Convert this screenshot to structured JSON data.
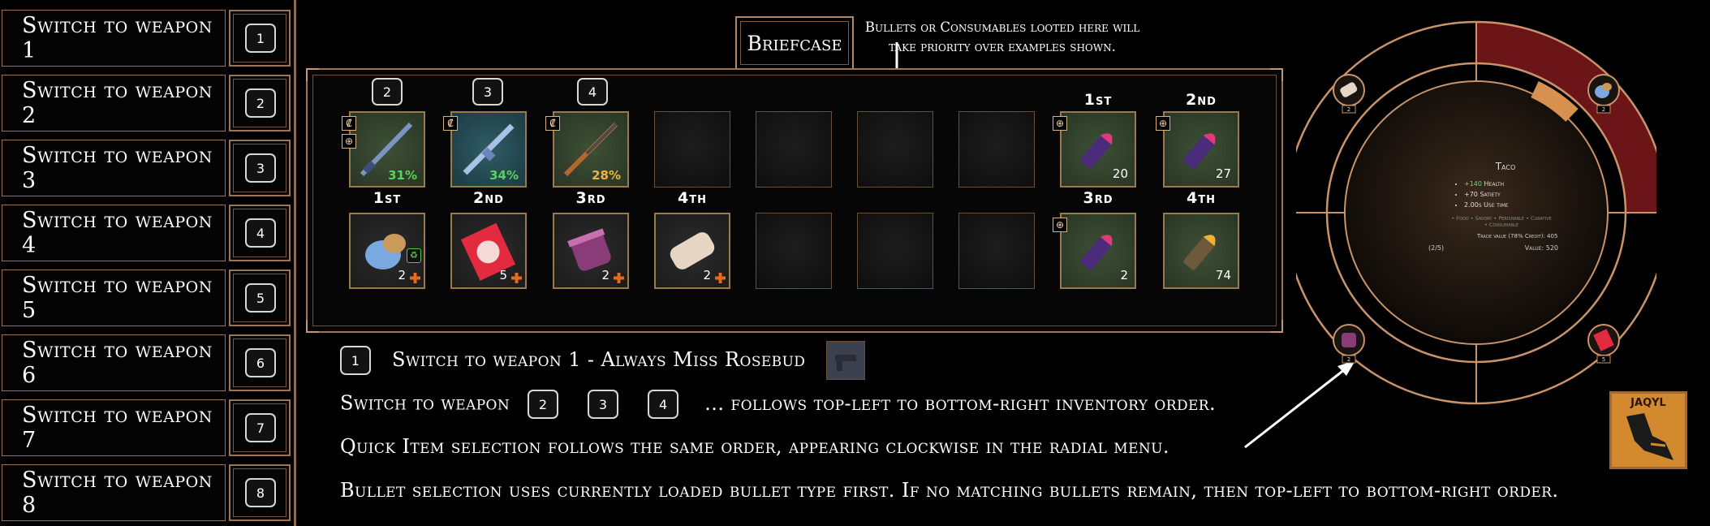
{
  "sidebar": {
    "items": [
      {
        "label": "Switch to weapon 1",
        "key": "1"
      },
      {
        "label": "Switch to weapon 2",
        "key": "2"
      },
      {
        "label": "Switch to weapon 3",
        "key": "3"
      },
      {
        "label": "Switch to weapon 4",
        "key": "4"
      },
      {
        "label": "Switch to weapon 5",
        "key": "5"
      },
      {
        "label": "Switch to weapon 6",
        "key": "6"
      },
      {
        "label": "Switch to weapon 7",
        "key": "7"
      },
      {
        "label": "Switch to weapon 8",
        "key": "8"
      }
    ]
  },
  "briefcase": {
    "title": "Briefcase",
    "note_line1": "Bullets or Consumables looted here will",
    "note_line2": "take priority over examples shown.",
    "weapon_keys": [
      "2",
      "3",
      "4"
    ],
    "weapons": [
      {
        "name": "shotgun",
        "durability": "31%"
      },
      {
        "name": "assault-rifle",
        "durability": "34%"
      },
      {
        "name": "hunting-rifle",
        "durability": "28%"
      }
    ],
    "top_right_labels": [
      "1st",
      "2nd"
    ],
    "bottom_labels_left": [
      "1st",
      "2nd",
      "3rd",
      "4th"
    ],
    "bottom_labels_right": [
      "3rd",
      "4th"
    ],
    "bullets": [
      {
        "name": "purple-bullet",
        "count": "20"
      },
      {
        "name": "purple-bullet",
        "count": "27"
      },
      {
        "name": "purple-bullet",
        "count": "2"
      },
      {
        "name": "gold-bullet",
        "count": "74"
      }
    ],
    "consumables": [
      {
        "name": "taco",
        "count": "2"
      },
      {
        "name": "candy-pack",
        "count": "5"
      },
      {
        "name": "jar",
        "count": "2"
      },
      {
        "name": "bandage",
        "count": "2"
      }
    ]
  },
  "explain": {
    "key1": "1",
    "line1": "Switch to weapon 1 - Always Miss Rosebud",
    "line2_prefix": "Switch to weapon",
    "line2_keys": [
      "2",
      "3",
      "4"
    ],
    "line2_suffix": "... follows top-left to bottom-right inventory order.",
    "line3": "Quick Item selection follows the same order, appearing clockwise in the radial menu.",
    "line4": "Bullet selection uses currently loaded bullet type first. If no matching bullets remain, then top-left to bottom-right order."
  },
  "radial": {
    "item_title": "Taco",
    "stats": [
      {
        "value": "+140",
        "label": "Health"
      },
      {
        "value": "+70",
        "label": "Satiety"
      },
      {
        "value": "2.00s",
        "label": "Use time"
      }
    ],
    "tags_line1": "• Food • Savory • Perishable • Curative",
    "tags_line2": "• Consumable",
    "trade_value": "Trade value (78% Credit): 405",
    "page": "(2/5)",
    "value": "Value: 520",
    "slot_counts": [
      "2",
      "2",
      "2",
      "5"
    ],
    "colors": {
      "accent": "#c9946a",
      "highlight": "#6b1519",
      "selected": "#d8904e"
    }
  },
  "logo": {
    "text": "JAQYL"
  }
}
